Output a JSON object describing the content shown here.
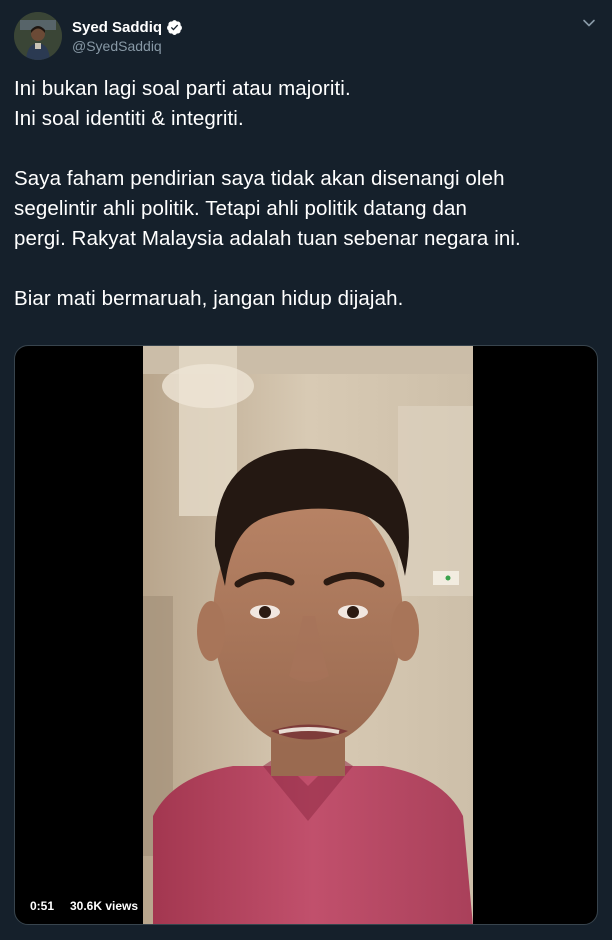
{
  "user": {
    "display_name": "Syed Saddiq",
    "handle": "@SyedSaddiq",
    "verified": true,
    "avatar_icon": "profile-avatar"
  },
  "tweet": {
    "lines": [
      "Ini bukan lagi soal parti atau majoriti.",
      "Ini soal identiti & integriti.",
      "",
      "Saya faham pendirian saya tidak akan disenangi oleh",
      "segelintir ahli politik. Tetapi ahli politik datang dan",
      "pergi. Rakyat Malaysia adalah tuan sebenar negara ini.",
      "",
      "Biar mati bermaruah, jangan hidup dijajah."
    ]
  },
  "video": {
    "duration": "0:51",
    "views": "30.6K views"
  },
  "colors": {
    "background": "#15202b",
    "text": "#ffffff",
    "secondary": "#8899a6",
    "verified": "#1da1f2",
    "shirt": "#b5405f"
  },
  "icons": {
    "more": "chevron-down-icon",
    "verified": "verified-badge-icon"
  }
}
